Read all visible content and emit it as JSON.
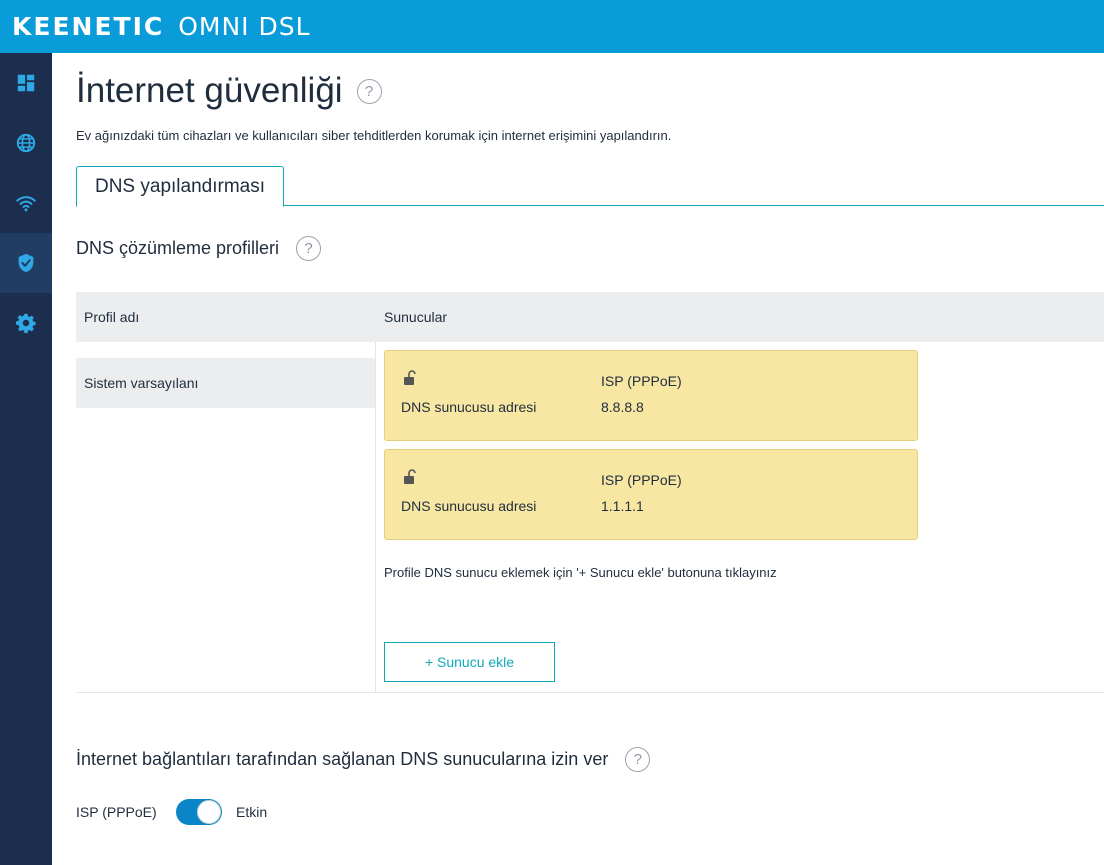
{
  "header": {
    "brand_name": "KEENETIC",
    "model": "OMNI DSL"
  },
  "sidebar": {
    "items": [
      {
        "name": "dashboard-icon",
        "active": false
      },
      {
        "name": "globe-icon",
        "active": false
      },
      {
        "name": "wifi-icon",
        "active": false
      },
      {
        "name": "shield-icon",
        "active": true
      },
      {
        "name": "gear-icon",
        "active": false
      }
    ]
  },
  "page": {
    "title": "İnternet güvenliği",
    "help": "?",
    "subtitle": "Ev ağınızdaki tüm cihazları ve kullanıcıları siber tehditlerden korumak için internet erişimini yapılandırın."
  },
  "tabs": [
    {
      "label": "DNS yapılandırması",
      "active": true
    }
  ],
  "dns_profiles": {
    "title": "DNS çözümleme profilleri",
    "columns": {
      "profile": "Profil adı",
      "servers": "Sunucular"
    },
    "rows": [
      {
        "profile": "Sistem varsayılanı",
        "servers": [
          {
            "source": "ISP (PPPoE)",
            "label": "DNS sunucusu adresi",
            "address": "8.8.8.8",
            "locked": true
          },
          {
            "source": "ISP (PPPoE)",
            "label": "DNS sunucusu adresi",
            "address": "1.1.1.1",
            "locked": true
          }
        ]
      }
    ],
    "hint": "Profile DNS sunucu eklemek için '+ Sunucu ekle' butonuna tıklayınız",
    "add_button": "+ Sunucu ekle"
  },
  "allow_isp_dns": {
    "title": "İnternet bağlantıları tarafından sağlanan DNS sunucularına izin ver",
    "connection": "ISP (PPPoE)",
    "enabled": true,
    "state_label": "Etkin"
  },
  "colors": {
    "header_bg": "#0a9bd9",
    "sidebar_bg": "#1b2e4d",
    "sidebar_icon": "#2fa8e6",
    "accent": "#12a8b8",
    "card_bg": "#f8e7a3",
    "toggle_on": "#0a86c8"
  }
}
